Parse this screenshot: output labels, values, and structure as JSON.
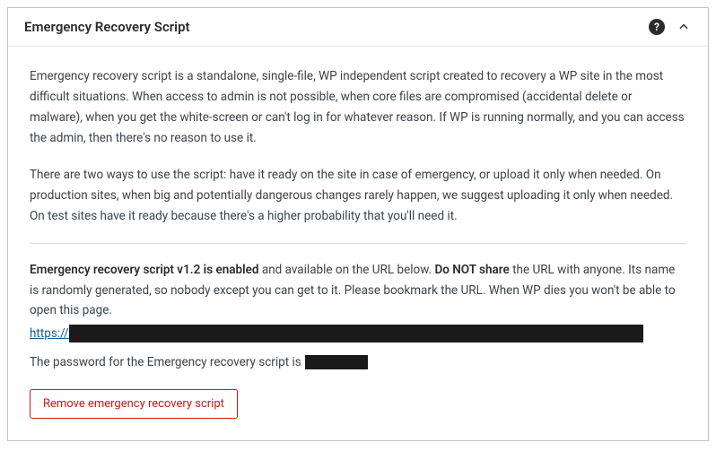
{
  "header": {
    "title": "Emergency Recovery Script"
  },
  "intro": {
    "p1": "Emergency recovery script is a standalone, single-file, WP independent script created to recovery a WP site in the most difficult situations. When access to admin is not possible, when core files are compromised (accidental delete or malware), when you get the white-screen or can't log in for whatever reason. If WP is running normally, and you can access the admin, then there's no reason to use it.",
    "p2": "There are two ways to use the script: have it ready on the site in case of emergency, or upload it only when needed. On production sites, when big and potentially dangerous changes rarely happen, we suggest uploading it only when needed. On test sites have it ready because there's a higher probability that you'll need it."
  },
  "status": {
    "bold1": "Emergency recovery script v1.2 is enabled",
    "mid1": " and available on the URL below. ",
    "bold2": "Do NOT share",
    "tail": " the URL with anyone. Its name is randomly generated, so nobody except you can get to it. Please bookmark the URL. When WP dies you won't be able to open this page."
  },
  "url": {
    "prefix": "https://"
  },
  "password": {
    "label": "The password for the Emergency recovery script is"
  },
  "actions": {
    "remove_label": "Remove emergency recovery script"
  }
}
